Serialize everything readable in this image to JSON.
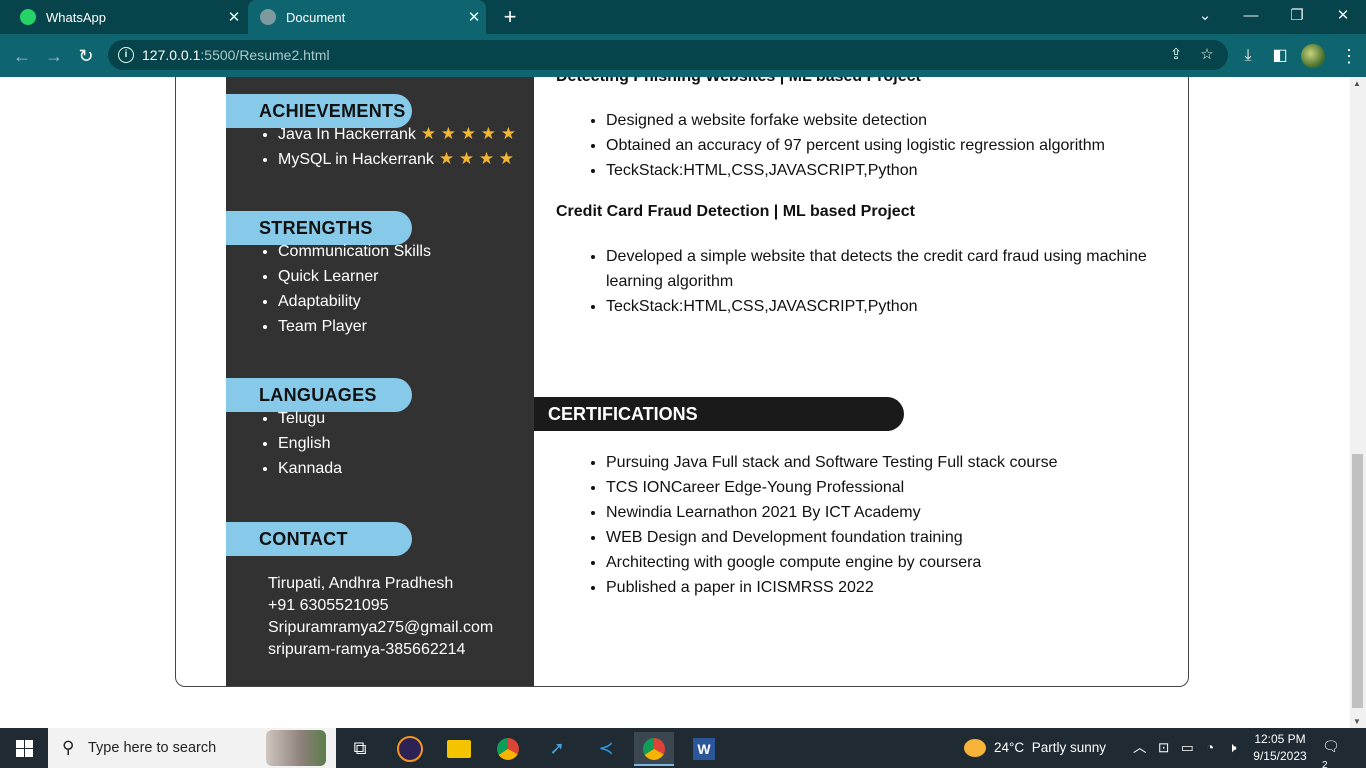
{
  "browser": {
    "tabs": [
      {
        "title": "WhatsApp",
        "active": false,
        "favicon": "whatsapp-icon",
        "color": "#25d366"
      },
      {
        "title": "Document",
        "active": true,
        "favicon": "globe-icon",
        "color": "#8aa"
      }
    ],
    "url_host": "127.0.0.1",
    "url_rest": ":5500/Resume2.html"
  },
  "sidebar": {
    "achievements": {
      "heading": "ACHIEVEMENTS",
      "items": [
        {
          "label": "Java In Hackerrank",
          "stars": "★ ★ ★ ★ ★",
          "rating": 5
        },
        {
          "label": "MySQL in Hackerrank",
          "stars": "★ ★ ★ ★",
          "rating": 4
        }
      ]
    },
    "strengths": {
      "heading": "STRENGTHS",
      "items": [
        "Communication Skills",
        "Quick Learner",
        "Adaptability",
        "Team Player"
      ]
    },
    "languages": {
      "heading": "LANGUAGES",
      "items": [
        "Telugu",
        "English",
        "Kannada"
      ]
    },
    "contact": {
      "heading": "CONTACT",
      "location": "Tirupati, Andhra Pradhesh",
      "phone": "+91  6305521095",
      "email": "Sripuramramya275@gmail.com",
      "linkedin": "sripuram-ramya-385662214"
    }
  },
  "main": {
    "projects": [
      {
        "title": "Detecting Phishing Websites | ML based Project",
        "points": [
          "Designed a website forfake website detection",
          "Obtained an accuracy of 97 percent using logistic regression algorithm",
          "TeckStack:HTML,CSS,JAVASCRIPT,Python"
        ]
      },
      {
        "title": "Credit Card Fraud Detection | ML based Project",
        "points": [
          "Developed a simple website that detects the credit card fraud using machine learning algorithm",
          "TeckStack:HTML,CSS,JAVASCRIPT,Python"
        ]
      }
    ],
    "certifications": {
      "heading": "CERTIFICATIONS",
      "items": [
        "Pursuing Java Full stack and Software Testing Full stack course",
        "TCS IONCareer Edge-Young Professional",
        "Newindia Learnathon 2021 By ICT Academy",
        "WEB Design and Development foundation training",
        "Architecting with google compute engine by coursera",
        "Published a paper in ICISMRSS 2022"
      ]
    }
  },
  "taskbar": {
    "search_placeholder": "Type here to search",
    "weather_temp": "24°C",
    "weather_text": "Partly sunny",
    "time": "12:05 PM",
    "date": "9/15/2023",
    "notification_count": "2"
  },
  "colors": {
    "tabbar": "#06434a",
    "toolbar": "#0e6570",
    "sidebar": "#323232",
    "pill": "#86c9e8",
    "cert_bar": "#1a1a1a",
    "star": "#f2b632"
  }
}
